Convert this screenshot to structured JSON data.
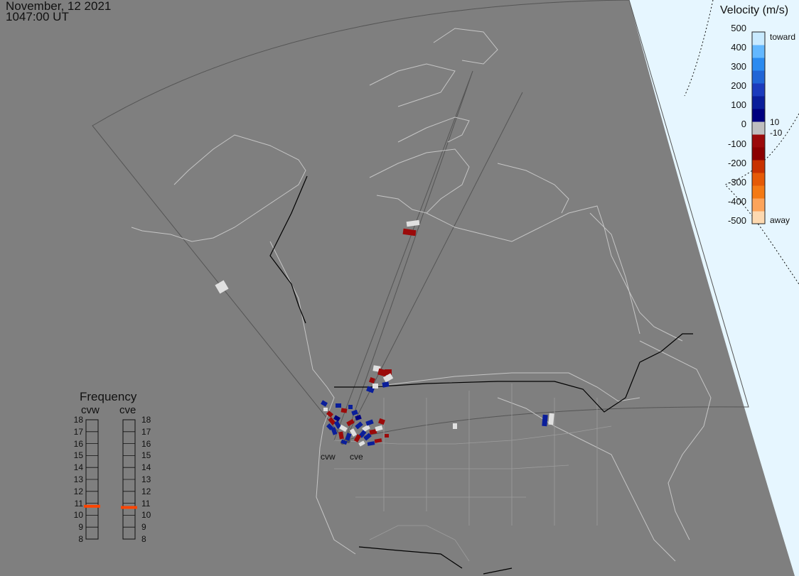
{
  "header": {
    "date": "November, 12 2021",
    "time": "1047:00 UT"
  },
  "colorbar": {
    "title": "Velocity (m/s)",
    "toward_label": "toward",
    "away_label": "away",
    "ticks_upper": [
      "500",
      "400",
      "300",
      "200",
      "100",
      "0"
    ],
    "ticks_lower": [
      "-100",
      "-200",
      "-300",
      "-400",
      "-500"
    ],
    "tick_small_pos": "10",
    "tick_small_neg": "-10",
    "colors": [
      "#fdd9b0",
      "#fca45a",
      "#f47a14",
      "#e55a06",
      "#c83200",
      "#8b0000",
      "#9b0a0a",
      "#bfbfbf",
      "#00007f",
      "#0a1e9a",
      "#1b3bbd",
      "#2065d6",
      "#2a8bf0",
      "#63b8ff",
      "#c8eaff"
    ]
  },
  "frequency": {
    "title": "Frequency",
    "radar_w": "cvw",
    "radar_e": "cve",
    "ticks": [
      "18",
      "17",
      "16",
      "15",
      "14",
      "13",
      "12",
      "11",
      "10",
      "9",
      "8"
    ],
    "cvw_value": 10.75,
    "cve_value": 10.65,
    "indicator_color": "#ff4500"
  },
  "radar_labels": {
    "west": "cvw",
    "east": "cve"
  },
  "map": {
    "ocean": "#7f7f7f",
    "night_edge": "#e6f6ff",
    "coast": "#c8c8c8",
    "border": "#000000"
  }
}
